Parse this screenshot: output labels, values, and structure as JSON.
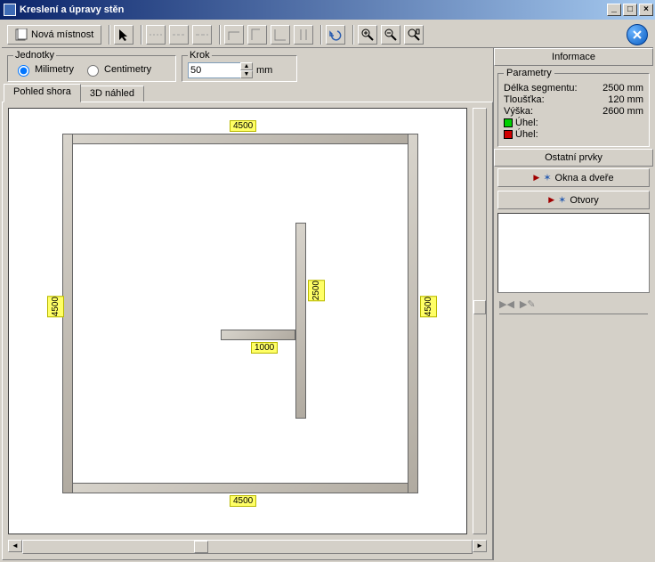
{
  "window": {
    "title": "Kreslení a úpravy stěn"
  },
  "toolbar": {
    "new_room": "Nová místnost"
  },
  "units": {
    "legend": "Jednotky",
    "mm_label": "Milimetry",
    "cm_label": "Centimetry"
  },
  "step": {
    "legend": "Krok",
    "value": "50",
    "unit": "mm"
  },
  "tabs": {
    "top_view": "Pohled shora",
    "preview_3d": "3D náhled"
  },
  "drawing": {
    "dim_outer_top": "4500",
    "dim_outer_bottom": "4500",
    "dim_outer_left": "4500",
    "dim_outer_right": "4500",
    "dim_inner_v": "2500",
    "dim_inner_h": "1000"
  },
  "info": {
    "header": "Informace",
    "params_legend": "Parametry",
    "length_label": "Délka segmentu:",
    "length_value": "2500 mm",
    "thickness_label": "Tloušťka:",
    "thickness_value": "120 mm",
    "height_label": "Výška:",
    "height_value": "2600 mm",
    "angle_label": "Úhel:"
  },
  "other": {
    "header": "Ostatní prvky",
    "windows_doors": "Okna a dveře",
    "openings": "Otvory"
  }
}
